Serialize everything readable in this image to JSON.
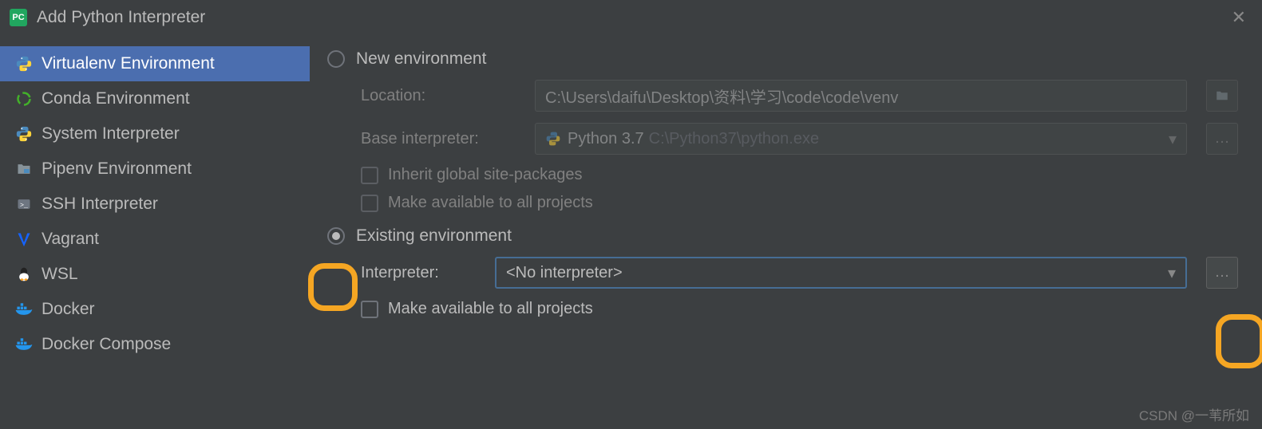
{
  "title": "Add Python Interpreter",
  "sidebar": {
    "items": [
      {
        "label": "Virtualenv Environment"
      },
      {
        "label": "Conda Environment"
      },
      {
        "label": "System Interpreter"
      },
      {
        "label": "Pipenv Environment"
      },
      {
        "label": "SSH Interpreter"
      },
      {
        "label": "Vagrant"
      },
      {
        "label": "WSL"
      },
      {
        "label": "Docker"
      },
      {
        "label": "Docker Compose"
      }
    ]
  },
  "new_env": {
    "radio_label": "New environment",
    "location_label": "Location:",
    "location_value": "C:\\Users\\daifu\\Desktop\\资料\\学习\\code\\code\\venv",
    "base_label": "Base interpreter:",
    "base_value": "Python 3.7",
    "base_path": "C:\\Python37\\python.exe",
    "inherit_label": "Inherit global site-packages",
    "avail_label": "Make available to all projects"
  },
  "existing_env": {
    "radio_label": "Existing environment",
    "interp_label": "Interpreter:",
    "interp_value": "<No interpreter>",
    "avail_label": "Make available to all projects"
  },
  "watermark": "CSDN @一苇所如"
}
